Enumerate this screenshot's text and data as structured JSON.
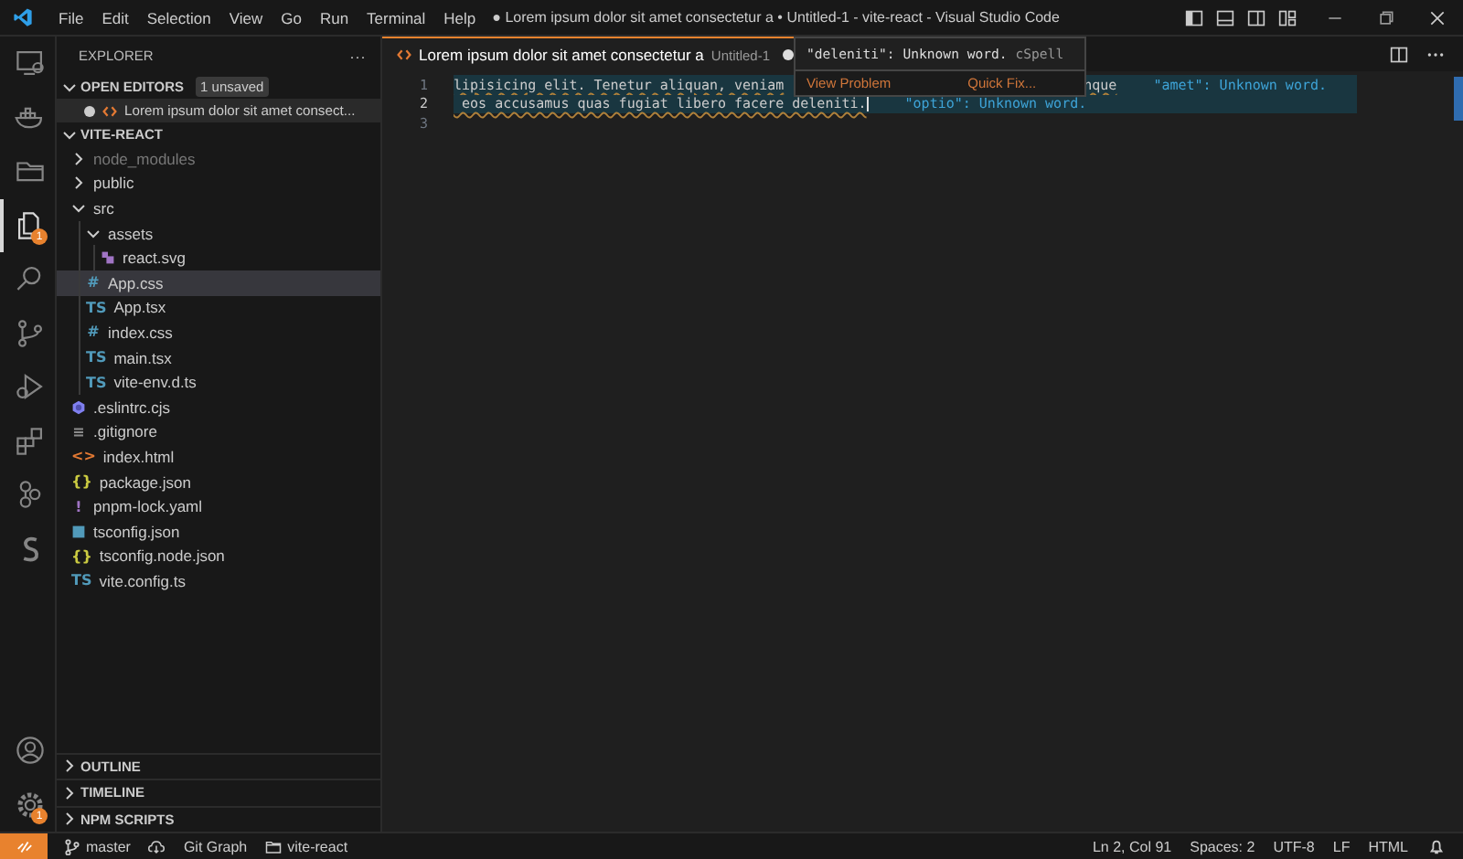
{
  "title_bar": {
    "menu": [
      "File",
      "Edit",
      "Selection",
      "View",
      "Go",
      "Run",
      "Terminal",
      "Help"
    ],
    "title": "● Lorem ipsum dolor sit amet consectetur a • Untitled-1 - vite-react - Visual Studio Code"
  },
  "activity_bar": {
    "items": [
      {
        "kind": "remote",
        "selected": false
      },
      {
        "kind": "docker",
        "selected": false
      },
      {
        "kind": "folder",
        "selected": false
      },
      {
        "kind": "explorer",
        "selected": true,
        "badge": "1"
      },
      {
        "kind": "search",
        "selected": false
      },
      {
        "kind": "branch",
        "selected": false
      },
      {
        "kind": "debug",
        "selected": false
      },
      {
        "kind": "extensions",
        "selected": false
      },
      {
        "kind": "graph",
        "selected": false
      },
      {
        "kind": "snippet",
        "selected": false
      }
    ],
    "bottom": [
      {
        "kind": "account"
      },
      {
        "kind": "settings",
        "badge": "1"
      }
    ]
  },
  "sidebar": {
    "title": "EXPLORER",
    "more": "···",
    "open_editors": {
      "label": "OPEN EDITORS",
      "badge": "1 unsaved",
      "expanded": true,
      "items": [
        {
          "label": "Lorem ipsum dolor sit amet consect...",
          "dirty": true
        }
      ]
    },
    "project": {
      "label": "VITE-REACT",
      "expanded": true,
      "children": [
        {
          "label": "node_modules",
          "kind": "folder",
          "expanded": false,
          "dim": true
        },
        {
          "label": "public",
          "kind": "folder",
          "expanded": false
        },
        {
          "label": "src",
          "kind": "folder",
          "expanded": true,
          "children": [
            {
              "label": "assets",
              "kind": "folder",
              "expanded": true,
              "children": [
                {
                  "label": "react.svg",
                  "kind": "svg"
                }
              ]
            },
            {
              "label": "App.css",
              "kind": "file",
              "glyph": "#",
              "color": "#519aba",
              "selected": true
            },
            {
              "label": "App.tsx",
              "kind": "file",
              "glyph": "TS",
              "color": "#519aba",
              "selected": false
            },
            {
              "label": "index.css",
              "kind": "file",
              "glyph": "#",
              "color": "#519aba",
              "selected": false
            },
            {
              "label": "main.tsx",
              "kind": "file",
              "glyph": "TS",
              "color": "#519aba",
              "selected": false
            },
            {
              "label": "vite-env.d.ts",
              "kind": "file",
              "glyph": "TS",
              "color": "#519aba",
              "selected": false
            }
          ]
        },
        {
          "label": ".eslintrc.cjs",
          "kind": "eslint"
        },
        {
          "label": ".gitignore",
          "kind": "file",
          "glyph": "≡",
          "color": "#8c8c8c",
          "selected": false
        },
        {
          "label": "index.html",
          "kind": "file",
          "glyph": "<>",
          "color": "#e37933",
          "selected": false
        },
        {
          "label": "package.json",
          "kind": "file",
          "glyph": "{}",
          "color": "#cbcb41",
          "selected": false
        },
        {
          "label": "pnpm-lock.yaml",
          "kind": "file",
          "glyph": "!",
          "color": "#a074c4",
          "selected": false
        },
        {
          "label": "tsconfig.json",
          "kind": "tsconfig"
        },
        {
          "label": "tsconfig.node.json",
          "kind": "file",
          "glyph": "{}",
          "color": "#cbcb41",
          "selected": false
        },
        {
          "label": "vite.config.ts",
          "kind": "file",
          "glyph": "TS",
          "color": "#519aba",
          "selected": false
        }
      ]
    },
    "sections": [
      {
        "label": "OUTLINE",
        "expanded": false
      },
      {
        "label": "TIMELINE",
        "expanded": false
      },
      {
        "label": "NPM SCRIPTS",
        "expanded": false
      }
    ]
  },
  "editor": {
    "tabs": [
      {
        "label": "Lorem ipsum dolor sit amet consectetur a",
        "description": "Untitled-1",
        "dirty": true,
        "selected": true
      }
    ],
    "lines": [
      {
        "number": "1",
        "current": false,
        "highlighted": true,
        "parts": [
          "lipisicing elit. Tenetur aliquan, veniam",
          "nque"
        ],
        "diagnostic": "\"amet\": Unknown word."
      },
      {
        "number": "2",
        "current": true,
        "highlighted": true,
        "parts": [
          " eos accusamus quas fugiat libero facere deleniti."
        ],
        "diagnostic": "\"optio\": Unknown word."
      },
      {
        "number": "3",
        "current": false,
        "highlighted": false
      }
    ],
    "hover": {
      "message": "\"deleniti\": Unknown word.",
      "source": "cSpell",
      "actions": [
        "View Problem",
        "Quick Fix..."
      ]
    }
  },
  "status_bar": {
    "left": [
      {
        "kind": "branch",
        "text": "master"
      },
      {
        "kind": "cloud"
      },
      {
        "kind": "plain",
        "text": "Git Graph"
      },
      {
        "kind": "folder",
        "text": "vite-react"
      }
    ],
    "right": [
      "Ln 2, Col 91",
      "Spaces: 2",
      "UTF-8",
      "LF",
      "HTML"
    ]
  }
}
